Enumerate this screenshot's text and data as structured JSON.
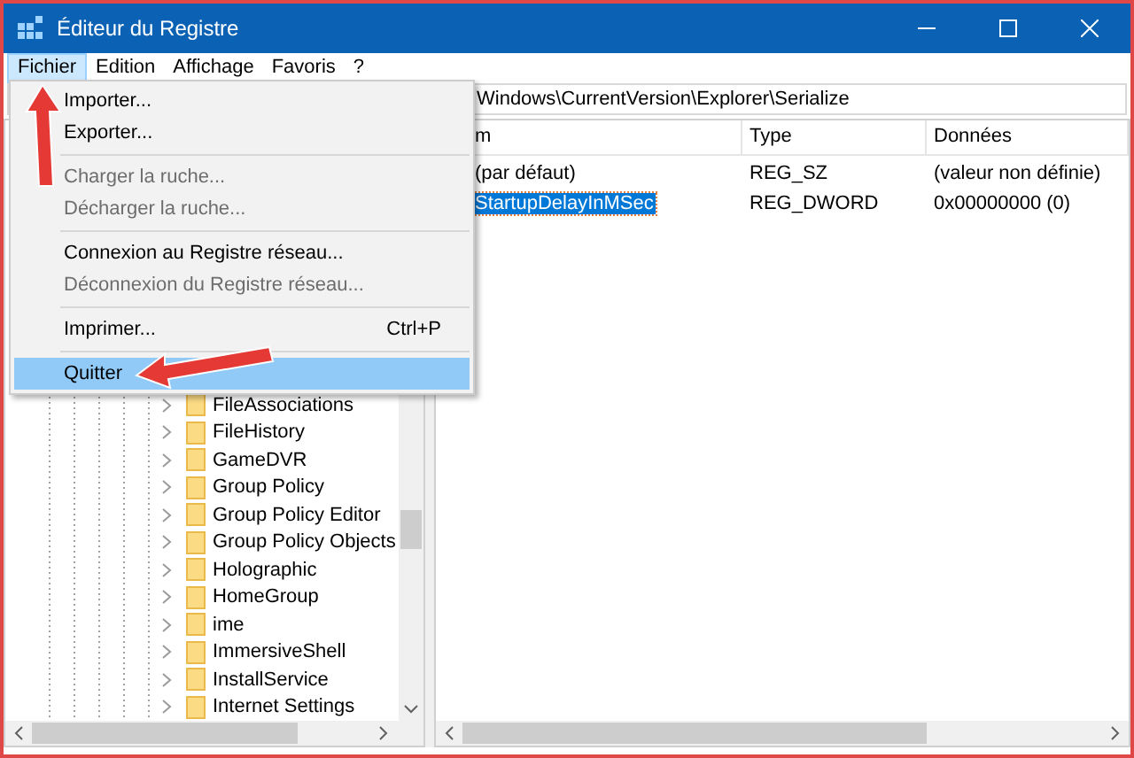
{
  "window": {
    "title": "Éditeur du Registre"
  },
  "menu_bar": [
    {
      "label": "Fichier",
      "selected": true
    },
    {
      "label": "Edition",
      "selected": false
    },
    {
      "label": "Affichage",
      "selected": false
    },
    {
      "label": "Favoris",
      "selected": false
    },
    {
      "label": "?",
      "selected": false
    }
  ],
  "file_menu": [
    {
      "kind": "item",
      "label": "Importer...",
      "disabled": false,
      "selected": false
    },
    {
      "kind": "item",
      "label": "Exporter...",
      "disabled": false,
      "selected": false
    },
    {
      "kind": "separator"
    },
    {
      "kind": "item",
      "label": "Charger la ruche...",
      "disabled": true,
      "selected": false
    },
    {
      "kind": "item",
      "label": "Décharger la ruche...",
      "disabled": true,
      "selected": false
    },
    {
      "kind": "separator"
    },
    {
      "kind": "item",
      "label": "Connexion au Registre réseau...",
      "disabled": false,
      "selected": false
    },
    {
      "kind": "item",
      "label": "Déconnexion du Registre réseau...",
      "disabled": true,
      "selected": false
    },
    {
      "kind": "separator"
    },
    {
      "kind": "item",
      "label": "Imprimer...",
      "shortcut": "Ctrl+P",
      "disabled": false,
      "selected": false
    },
    {
      "kind": "separator"
    },
    {
      "kind": "item",
      "label": "Quitter",
      "disabled": false,
      "selected": true
    }
  ],
  "address": "Windows\\CurrentVersion\\Explorer\\Serialize",
  "tree": [
    "FileAssociations",
    "FileHistory",
    "GameDVR",
    "Group Policy",
    "Group Policy Editor",
    "Group Policy Objects",
    "Holographic",
    "HomeGroup",
    "ime",
    "ImmersiveShell",
    "InstallService",
    "Internet Settings"
  ],
  "list": {
    "columns": [
      "m",
      "Type",
      "Données"
    ],
    "rows": [
      {
        "name": "(par défaut)",
        "type": "REG_SZ",
        "data": "(valeur non définie)",
        "selected": false
      },
      {
        "name": "StartupDelayInMSec",
        "type": "REG_DWORD",
        "data": "0x00000000 (0)",
        "selected": true
      }
    ]
  }
}
